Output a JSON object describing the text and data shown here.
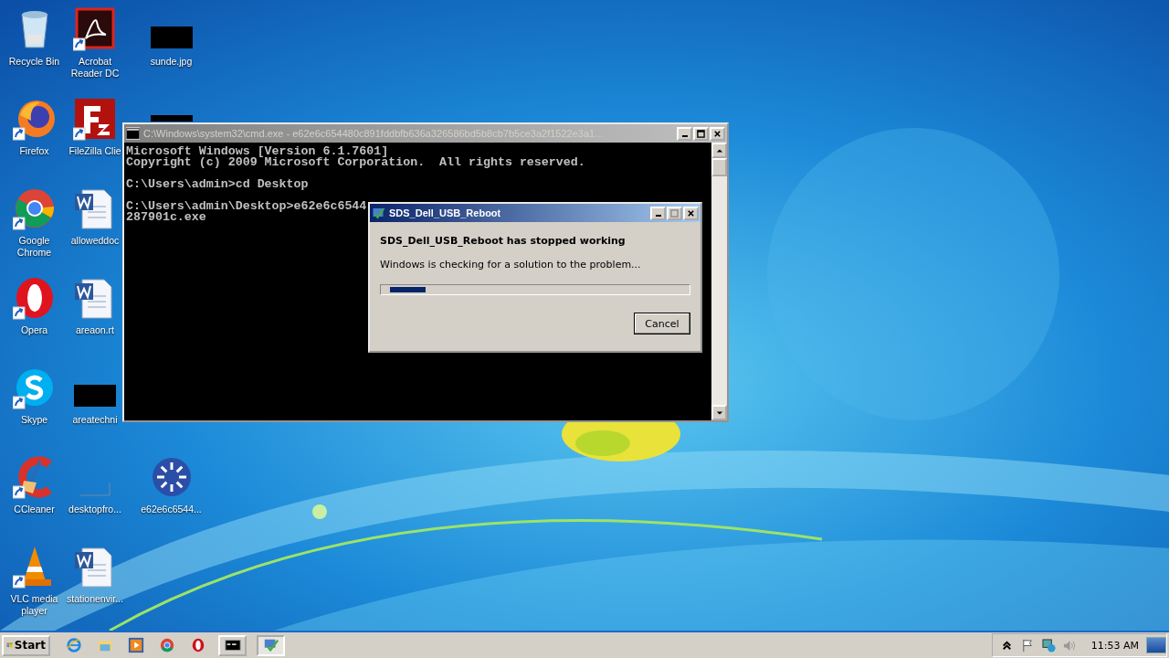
{
  "desktop": {
    "columns": [
      [
        {
          "kind": "recycle",
          "label": "Recycle Bin",
          "shortcut": false
        },
        {
          "kind": "firefox",
          "label": "Firefox",
          "shortcut": true
        },
        {
          "kind": "chrome",
          "label": "Google Chrome",
          "shortcut": true
        },
        {
          "kind": "opera",
          "label": "Opera",
          "shortcut": true
        },
        {
          "kind": "skype",
          "label": "Skype",
          "shortcut": true
        },
        {
          "kind": "ccleaner",
          "label": "CCleaner",
          "shortcut": true
        },
        {
          "kind": "vlc",
          "label": "VLC media player",
          "shortcut": true
        }
      ],
      [
        {
          "kind": "acrobat",
          "label": "Acrobat Reader DC",
          "shortcut": true
        },
        {
          "kind": "filezilla",
          "label": "FileZilla Clie",
          "shortcut": true
        },
        {
          "kind": "word",
          "label": "alloweddoc",
          "shortcut": false
        },
        {
          "kind": "word",
          "label": "areaon.rt",
          "shortcut": false
        },
        {
          "kind": "thumb",
          "label": "areatechni",
          "shortcut": false
        },
        {
          "kind": "blank",
          "label": "desktopfro...",
          "shortcut": false
        },
        {
          "kind": "word",
          "label": "stationenvir...",
          "shortcut": false
        }
      ],
      [
        {
          "kind": "thumb",
          "label": "sunde.jpg",
          "shortcut": false
        },
        {
          "kind": "thumb-top",
          "shortcut": false
        },
        {
          "kind": "empty"
        },
        {
          "kind": "empty"
        },
        {
          "kind": "empty"
        },
        {
          "kind": "spinner",
          "label": "e62e6c6544...",
          "shortcut": false
        }
      ]
    ]
  },
  "console": {
    "title": "C:\\Windows\\system32\\cmd.exe - e62e6c654480c891fddbfb636a326586bd5b8cb7b5ce3a2f1522e3a1...",
    "active": false,
    "blocks": [
      [
        "Microsoft Windows [Version 6.1.7601]",
        "Copyright (c) 2009 Microsoft Corporation.  All rights reserved."
      ],
      [
        "C:\\Users\\admin>cd Desktop"
      ],
      [
        "C:\\Users\\admin\\Desktop>e62e6c6544",
        "287901c.exe"
      ]
    ]
  },
  "dialog": {
    "title": "SDS_Dell_USB_Reboot",
    "active": true,
    "heading": "SDS_Dell_USB_Reboot has stopped working",
    "message": "Windows is checking for a solution to the problem...",
    "button": "Cancel",
    "progress": {
      "level": 0.12
    }
  },
  "taskbar": {
    "start": "Start",
    "items": [
      {
        "kind": "ie"
      },
      {
        "kind": "folder"
      },
      {
        "kind": "media"
      },
      {
        "kind": "chrome"
      },
      {
        "kind": "opera"
      },
      {
        "kind": "console",
        "selected": false
      },
      {
        "kind": "app",
        "selected": true
      }
    ],
    "tray": {
      "clock": "11:53 AM"
    }
  }
}
